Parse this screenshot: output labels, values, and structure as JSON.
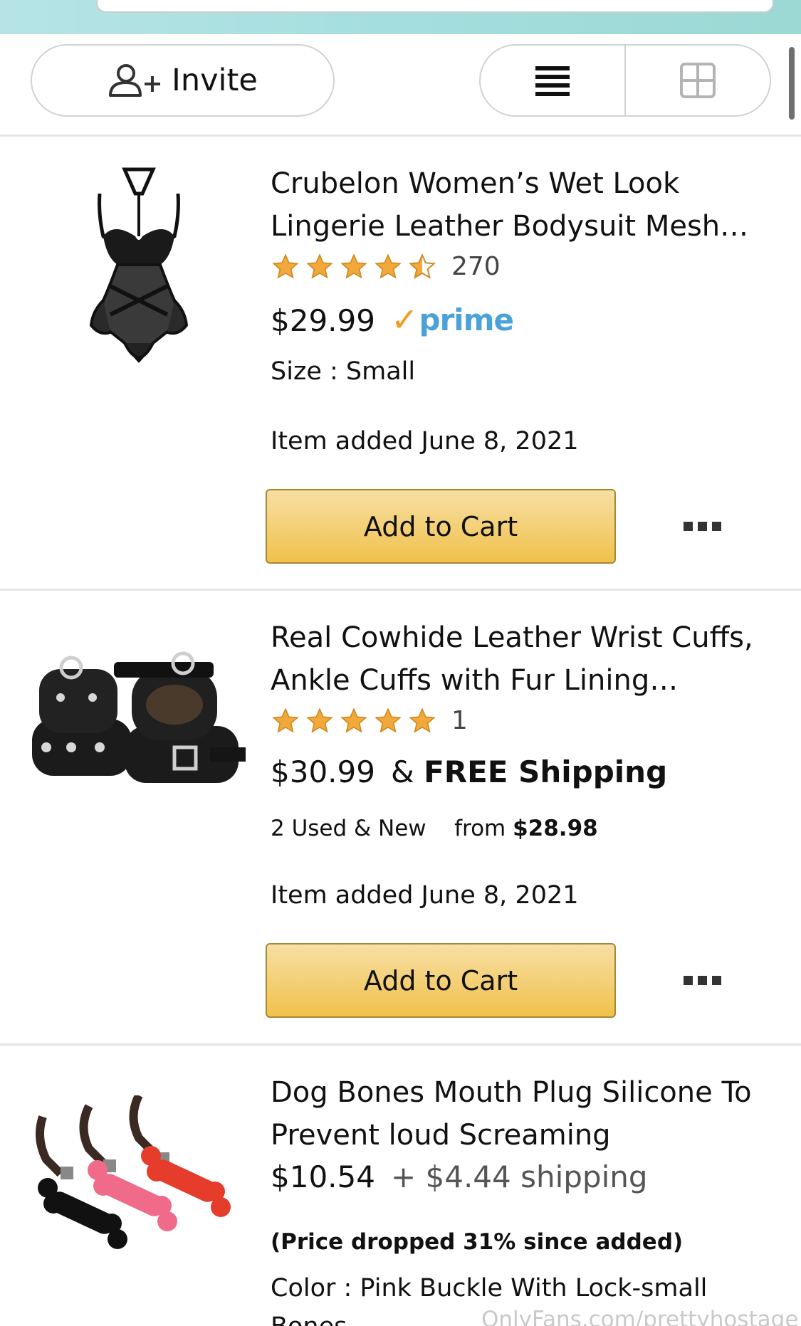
{
  "toolbar": {
    "invite_label": "Invite"
  },
  "items": [
    {
      "title_line1": "Crubelon Women’s Wet Look",
      "title_line2": "Lingerie Leather Bodysuit Mesh…",
      "rating_stars": 4.5,
      "rating_count": "270",
      "price": "$29.99",
      "prime_label": "prime",
      "size": "Size : Small",
      "added": "Item added June 8, 2021",
      "cart_label": "Add to Cart"
    },
    {
      "title_line1": "Real Cowhide Leather Wrist Cuffs,",
      "title_line2": "Ankle Cuffs with Fur Lining…",
      "rating_stars": 5,
      "rating_count": "1",
      "price": "$30.99",
      "shipping_prefix": "& ",
      "shipping_bold": "FREE Shipping",
      "used_new": "2 Used & New",
      "from_label": "from ",
      "from_price": "$28.98",
      "added": "Item added June 8, 2021",
      "cart_label": "Add to Cart"
    },
    {
      "title_line1": "Dog Bones Mouth Plug Silicone To",
      "title_line2": "Prevent loud Screaming",
      "price": "$10.54",
      "shipping": "+ $4.44 shipping",
      "price_drop": "(Price dropped 31% since added)",
      "color_line1": "Color : Pink Buckle With Lock-small",
      "color_line2": "Bones"
    }
  ],
  "watermark": "OnlyFans.com/prettyhostage",
  "colors": {
    "cart_button": "#f0c14b",
    "prime_blue": "#4aa2d8",
    "prime_check": "#f39c1d",
    "star": "#f2a93b",
    "topbar": "#a4dede"
  }
}
